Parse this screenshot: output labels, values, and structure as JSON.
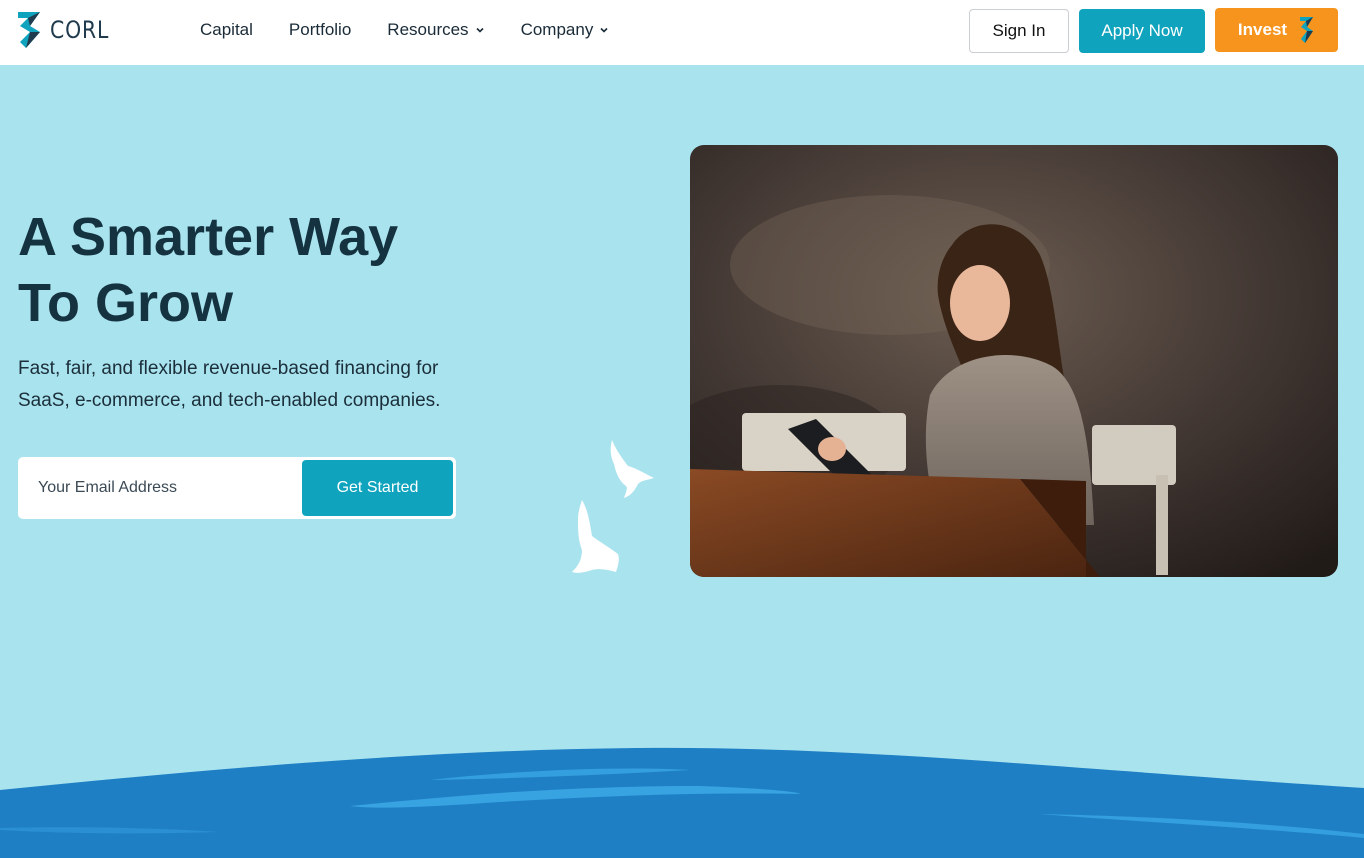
{
  "brand": {
    "name": "CORL",
    "color_dark": "#1f3b4d",
    "color_teal": "#0fa3bd"
  },
  "nav": {
    "items": [
      {
        "label": "Capital",
        "has_dropdown": false
      },
      {
        "label": "Portfolio",
        "has_dropdown": false
      },
      {
        "label": "Resources",
        "has_dropdown": true
      },
      {
        "label": "Company",
        "has_dropdown": true
      }
    ]
  },
  "header_buttons": {
    "sign_in": "Sign In",
    "apply_now": "Apply Now",
    "invest": "Invest"
  },
  "hero": {
    "title_line1": "A Smarter Way",
    "title_line2": "To Grow",
    "subtitle_line1": "Fast, fair, and flexible revenue-based financing for",
    "subtitle_line2": "SaaS, e-commerce, and tech-enabled companies.",
    "email_placeholder": "Your Email Address",
    "cta_label": "Get Started"
  },
  "colors": {
    "background": "#a9e3ee",
    "accent_teal": "#0fa3bd",
    "accent_orange": "#f7941d",
    "heading": "#14323f",
    "wave": "#1f7fc5"
  },
  "icons": [
    "corl-logo-icon",
    "chevron-down-icon",
    "bird-illustration-icon",
    "wave-illustration"
  ]
}
